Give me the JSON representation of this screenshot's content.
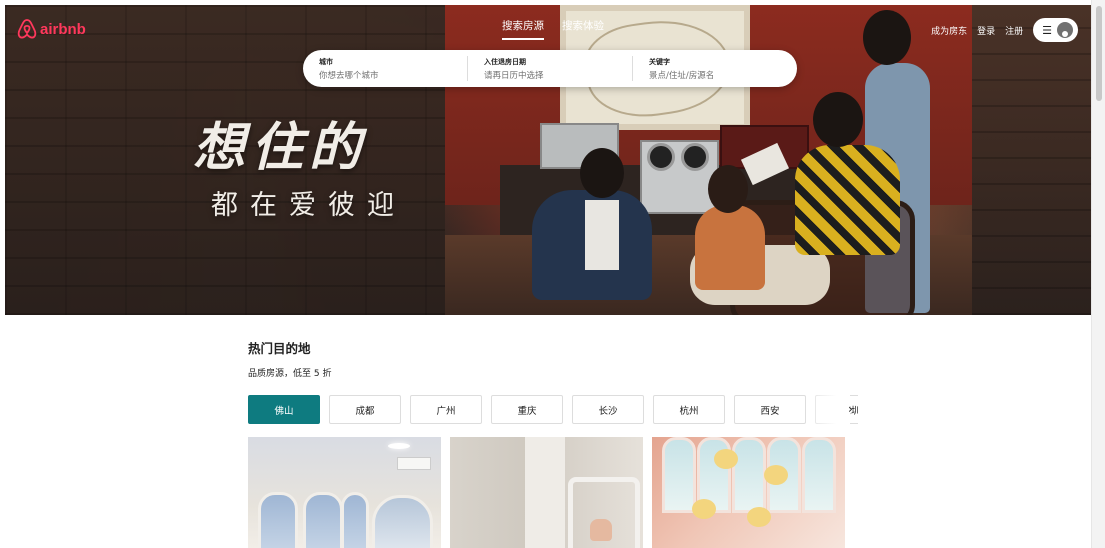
{
  "brand": {
    "name": "airbnb",
    "color": "#ff385c"
  },
  "nav": {
    "tabs": [
      {
        "label": "搜索房源",
        "active": true
      },
      {
        "label": "搜索体验",
        "active": false
      }
    ],
    "host_link": "成为房东",
    "login_link": "登录",
    "register_link": "注册",
    "menu_icon": "hamburger-icon",
    "avatar_icon": "user-icon"
  },
  "search": {
    "fields": [
      {
        "label": "城市",
        "placeholder": "你想去哪个城市"
      },
      {
        "label": "入住退房日期",
        "placeholder": "请再日历中选择"
      },
      {
        "label": "关键字",
        "placeholder": "景点/住址/房源名"
      }
    ]
  },
  "hero": {
    "headline": "想住的",
    "subline": "都在爱彼迎"
  },
  "popular": {
    "title": "热门目的地",
    "subtitle": "品质房源，低至 5 折",
    "active_color": "#0e7b80",
    "cities": [
      {
        "label": "佛山",
        "active": true
      },
      {
        "label": "成都",
        "active": false
      },
      {
        "label": "广州",
        "active": false
      },
      {
        "label": "重庆",
        "active": false
      },
      {
        "label": "长沙",
        "active": false
      },
      {
        "label": "杭州",
        "active": false
      },
      {
        "label": "西安",
        "active": false
      },
      {
        "label": "深圳",
        "active": false
      }
    ],
    "next_icon": "chevron-right-icon"
  }
}
